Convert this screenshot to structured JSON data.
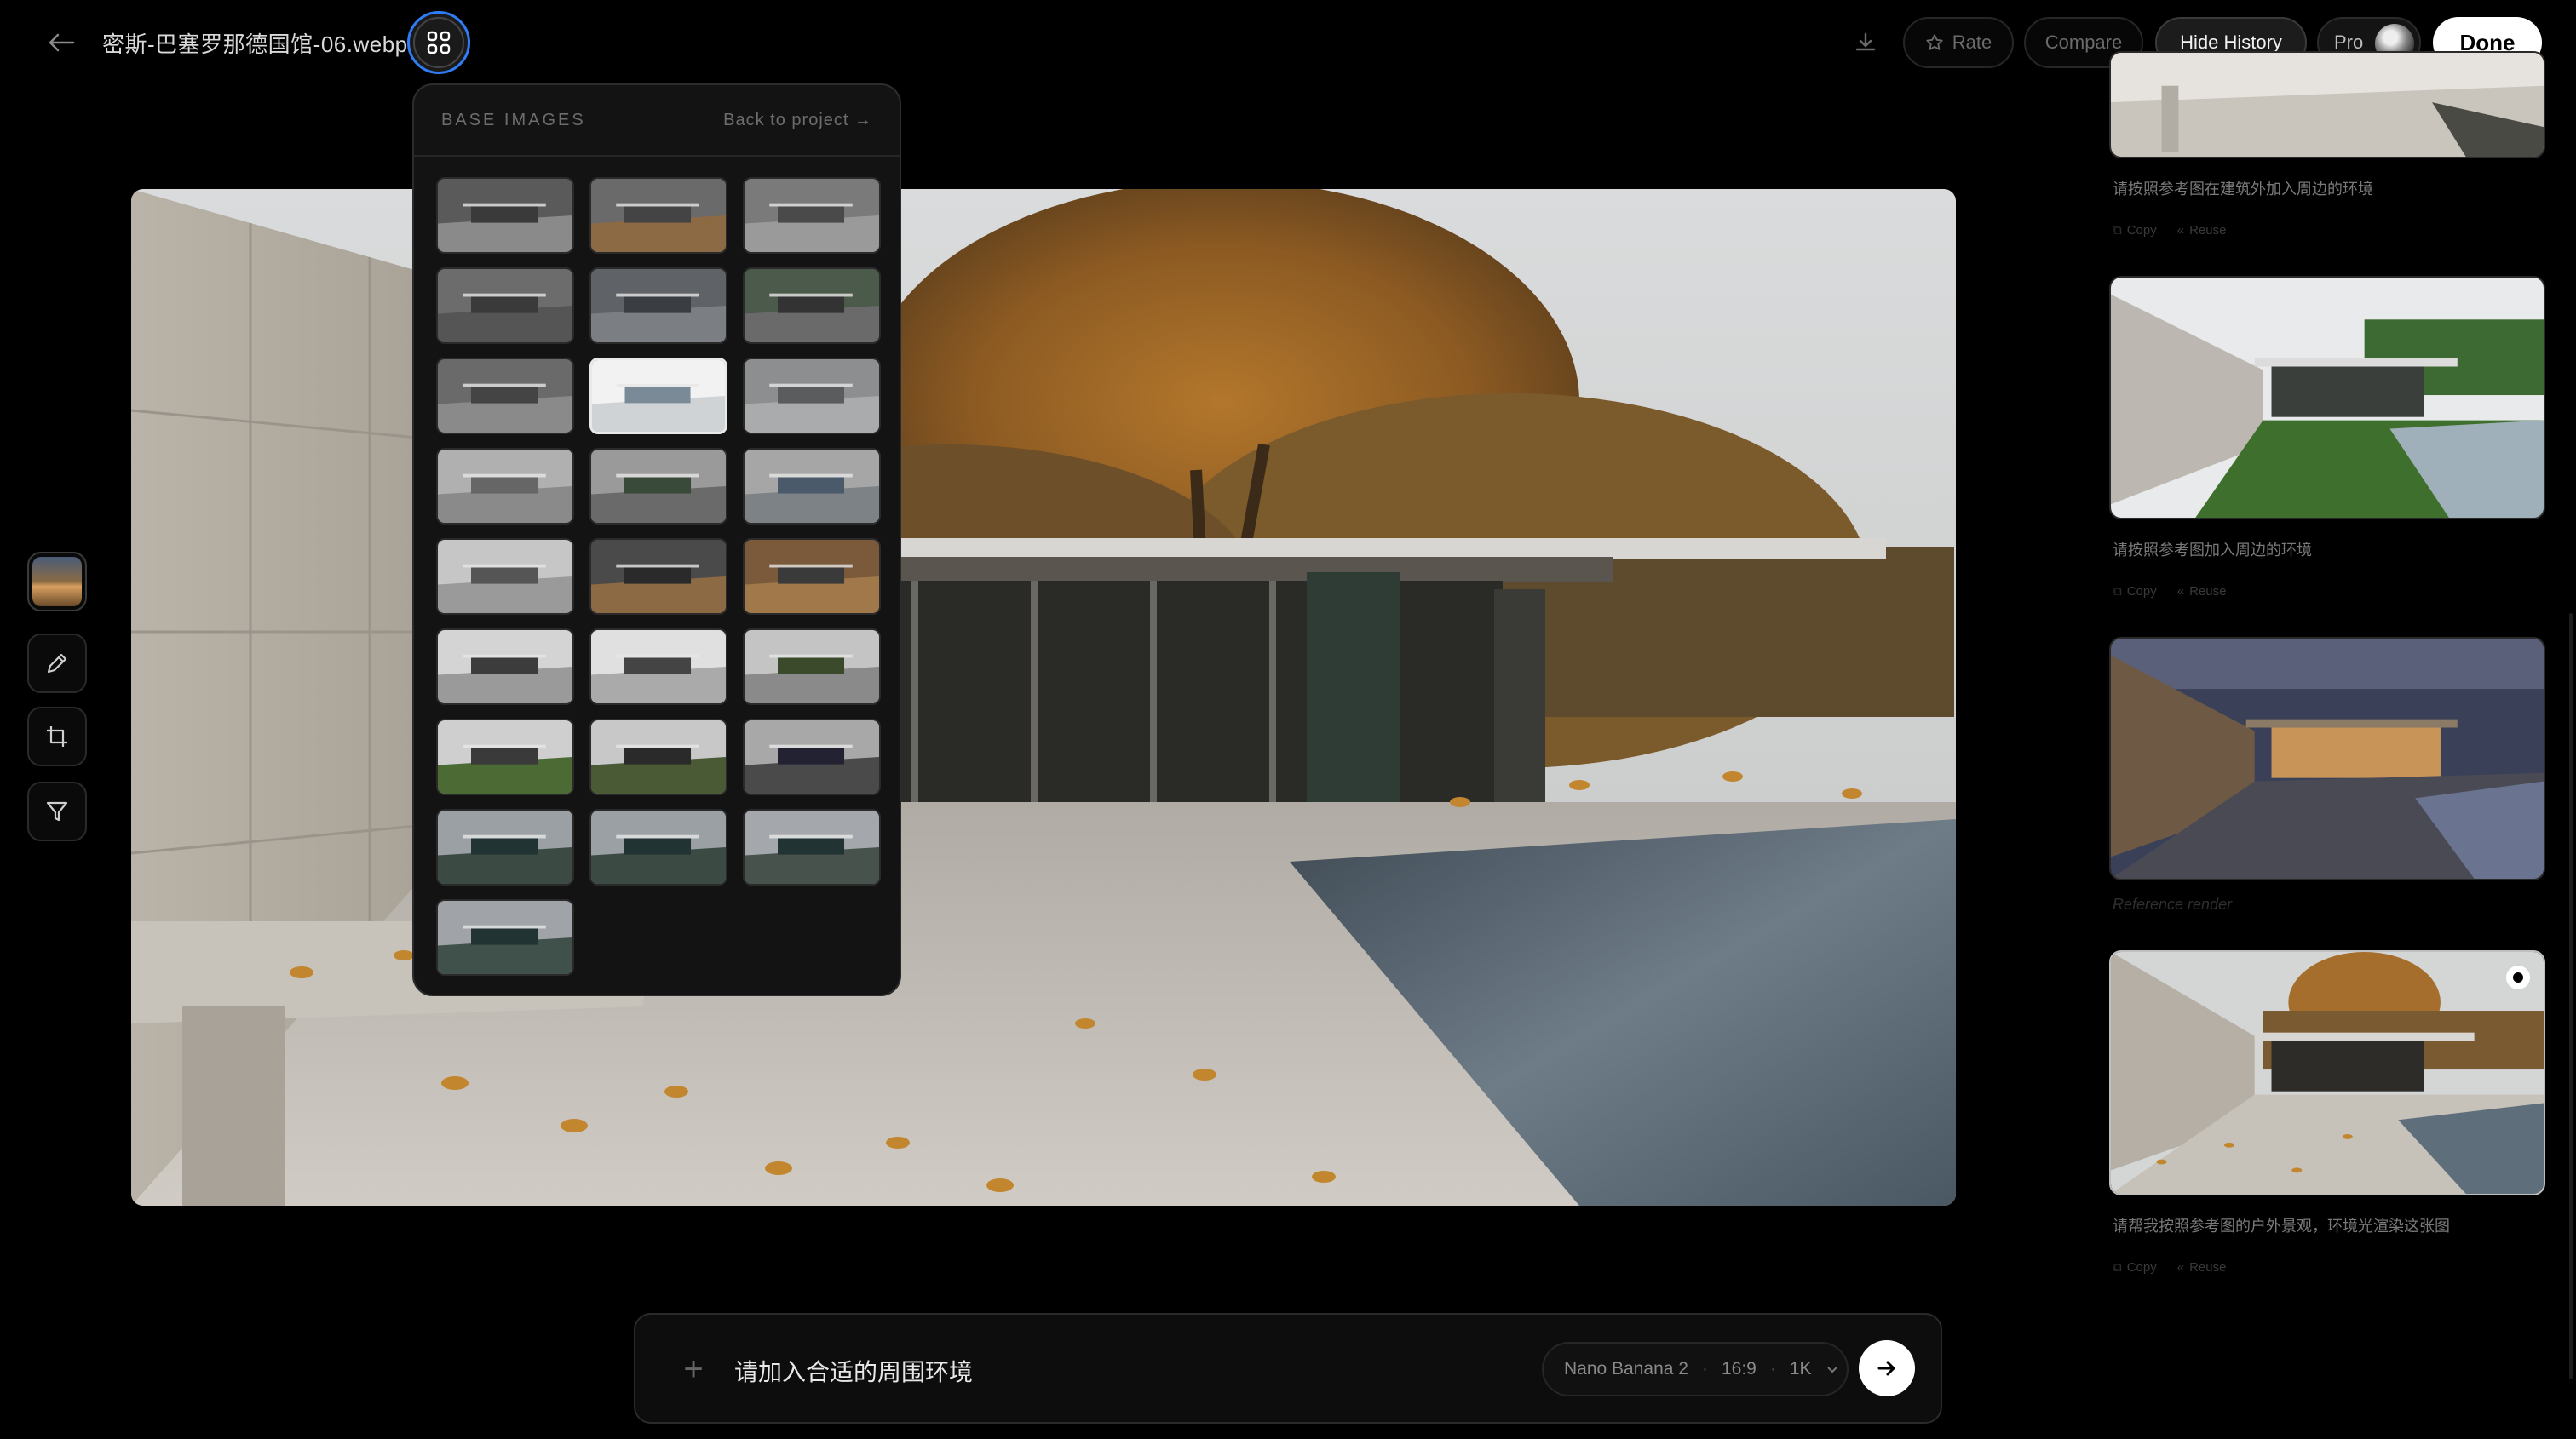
{
  "header": {
    "file_name": "密斯-巴塞罗那德国馆-06.webp",
    "rate_label": "Rate",
    "compare_label": "Compare",
    "hide_history_label": "Hide History",
    "pro_label": "Pro",
    "done_label": "Done"
  },
  "base_images_panel": {
    "title": "BASE IMAGES",
    "back_link": "Back to project →",
    "thumbnail_count": 25,
    "selected_index": 7
  },
  "history": [
    {
      "prompt": "请按照参考图在建筑外加入周边的环境",
      "copy": "Copy",
      "reuse": "Reuse"
    },
    {
      "prompt": "请按照参考图加入周边的环境",
      "copy": "Copy",
      "reuse": "Reuse"
    },
    {
      "prompt": "Reference render"
    },
    {
      "prompt": "请帮我按照参考图的户外景观，环境光渲染这张图",
      "copy": "Copy",
      "reuse": "Reuse"
    }
  ],
  "prompt_bar": {
    "text": "请加入合适的周围环境",
    "model": "Nano Banana 2",
    "ratio": "16:9",
    "resolution": "1K"
  },
  "colors": {
    "accent": "#2f7df6",
    "background": "#000000",
    "panel": "#131313"
  }
}
